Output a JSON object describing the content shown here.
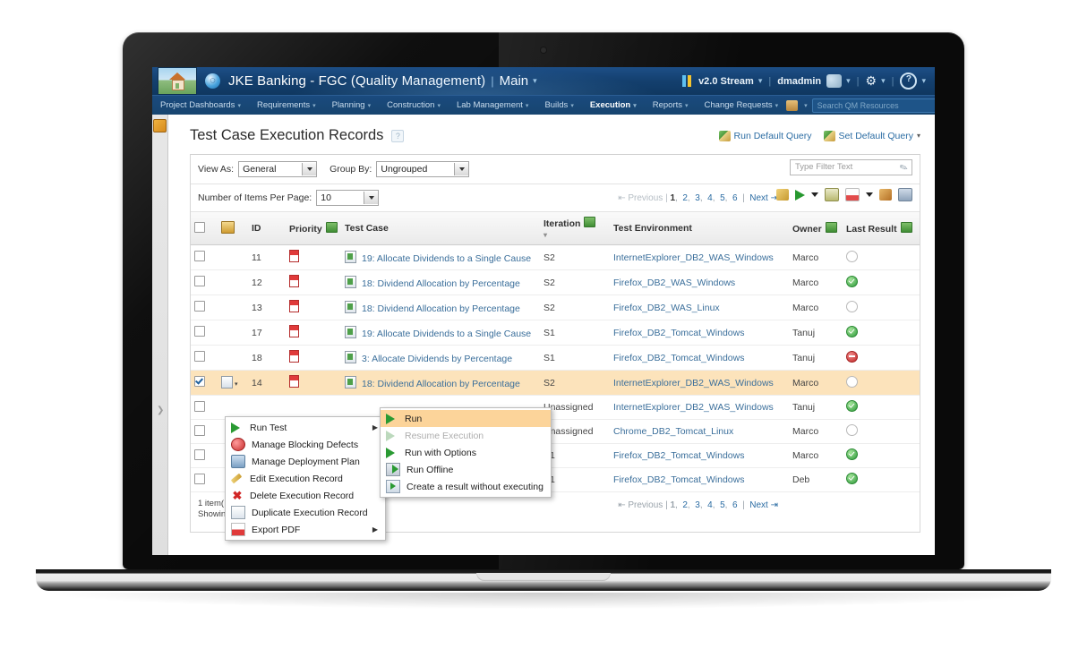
{
  "banner": {
    "home_icon": "home-icon",
    "logo_icon": "jazz-logo-icon",
    "title": "JKE Banking - FGC (Quality Management)",
    "separator": "|",
    "main_label": "Main",
    "stream_label": "v2.0 Stream",
    "user_label": "dmadmin",
    "people_icon": "people-icon",
    "gear_icon": "gear-icon",
    "help_icon": "help-icon"
  },
  "nav": {
    "items": [
      {
        "label": "Project Dashboards",
        "active": false
      },
      {
        "label": "Requirements",
        "active": false
      },
      {
        "label": "Planning",
        "active": false
      },
      {
        "label": "Construction",
        "active": false
      },
      {
        "label": "Lab Management",
        "active": false
      },
      {
        "label": "Builds",
        "active": false
      },
      {
        "label": "Execution",
        "active": true
      },
      {
        "label": "Reports",
        "active": false
      },
      {
        "label": "Change Requests",
        "active": false
      }
    ],
    "search_placeholder": "Search QM Resources",
    "search_icon": "search-icon"
  },
  "page": {
    "title": "Test Case Execution Records",
    "help_icon": "question-mark-icon",
    "run_default_query": "Run Default Query",
    "set_default_query": "Set Default Query"
  },
  "filters": {
    "view_as_label": "View As:",
    "view_as_value": "General",
    "group_by_label": "Group By:",
    "group_by_value": "Ungrouped",
    "filter_placeholder": "Type Filter Text",
    "filter_icon": "filter-pen-icon"
  },
  "paging": {
    "items_per_page_label": "Number of Items Per Page:",
    "items_per_page_value": "10",
    "first_icon": "first-page-icon",
    "previous": "Previous",
    "pages": [
      "1",
      "2",
      "3",
      "4",
      "5",
      "6"
    ],
    "current_page": "1",
    "next": "Next",
    "last_icon": "last-page-icon",
    "separator": "|"
  },
  "toolbar_icons": [
    {
      "name": "link-icon"
    },
    {
      "name": "run-icon"
    },
    {
      "name": "run-dropdown-icon"
    },
    {
      "name": "columns-icon"
    },
    {
      "name": "pdf-icon"
    },
    {
      "name": "pdf-dropdown-icon"
    },
    {
      "name": "export-icon"
    },
    {
      "name": "grid-icon"
    }
  ],
  "table": {
    "columns": [
      {
        "label": "",
        "key": "checkbox"
      },
      {
        "label": "",
        "key": "icon"
      },
      {
        "label": "ID",
        "key": "id"
      },
      {
        "label": "Priority",
        "key": "priority",
        "sortable": true
      },
      {
        "label": "Test Case",
        "key": "testcase"
      },
      {
        "label": "Iteration",
        "key": "iteration",
        "sortable": true
      },
      {
        "label": "Test Environment",
        "key": "environment"
      },
      {
        "label": "Owner",
        "key": "owner",
        "sortable": true
      },
      {
        "label": "Last Result",
        "key": "result",
        "sortable": true
      }
    ],
    "rows": [
      {
        "id": "11",
        "testcase": "19: Allocate Dividends to a Single Cause",
        "iteration": "S2",
        "environment": "InternetExplorer_DB2_WAS_Windows",
        "owner": "Marco",
        "result": "none",
        "selected": false
      },
      {
        "id": "12",
        "testcase": "18: Dividend Allocation by Percentage",
        "iteration": "S2",
        "environment": "Firefox_DB2_WAS_Windows",
        "owner": "Marco",
        "result": "pass",
        "selected": false
      },
      {
        "id": "13",
        "testcase": "18: Dividend Allocation by Percentage",
        "iteration": "S2",
        "environment": "Firefox_DB2_WAS_Linux",
        "owner": "Marco",
        "result": "none",
        "selected": false
      },
      {
        "id": "17",
        "testcase": "19: Allocate Dividends to a Single Cause",
        "iteration": "S1",
        "environment": "Firefox_DB2_Tomcat_Windows",
        "owner": "Tanuj",
        "result": "pass",
        "selected": false
      },
      {
        "id": "18",
        "testcase": "3: Allocate Dividends by Percentage",
        "iteration": "S1",
        "environment": "Firefox_DB2_Tomcat_Windows",
        "owner": "Tanuj",
        "result": "block",
        "selected": false
      },
      {
        "id": "14",
        "testcase": "18: Dividend Allocation by Percentage",
        "iteration": "S2",
        "environment": "InternetExplorer_DB2_WAS_Windows",
        "owner": "Marco",
        "result": "none",
        "selected": true
      },
      {
        "id": "",
        "testcase": "",
        "iteration": "Unassigned",
        "environment": "InternetExplorer_DB2_WAS_Windows",
        "owner": "Tanuj",
        "result": "pass",
        "selected": false
      },
      {
        "id": "",
        "testcase": "",
        "iteration": "Unassigned",
        "environment": "Chrome_DB2_Tomcat_Linux",
        "owner": "Marco",
        "result": "none",
        "selected": false
      },
      {
        "id": "",
        "testcase": "",
        "iteration": "S1",
        "environment": "Firefox_DB2_Tomcat_Windows",
        "owner": "Marco",
        "result": "pass",
        "selected": false
      },
      {
        "id": "",
        "testcase": "",
        "iteration": "S1",
        "environment": "Firefox_DB2_Tomcat_Windows",
        "owner": "Deb",
        "result": "pass",
        "selected": false
      }
    ]
  },
  "footer": {
    "count_line1": "1 item(",
    "count_line2": "Showin"
  },
  "context_menu": {
    "items": [
      {
        "label": "Run Test",
        "icon": "run-icon",
        "submenu": true,
        "disabled": false
      },
      {
        "label": "Manage Blocking Defects",
        "icon": "defect-icon",
        "submenu": false,
        "disabled": false
      },
      {
        "label": "Manage Deployment Plan",
        "icon": "deployment-icon",
        "submenu": false,
        "disabled": false
      },
      {
        "label": "Edit Execution Record",
        "icon": "pencil-icon",
        "submenu": false,
        "disabled": false
      },
      {
        "label": "Delete Execution Record",
        "icon": "delete-x-icon",
        "submenu": false,
        "disabled": false
      },
      {
        "label": "Duplicate Execution Record",
        "icon": "duplicate-icon",
        "submenu": false,
        "disabled": false
      },
      {
        "label": "Export PDF",
        "icon": "pdf-icon",
        "submenu": true,
        "disabled": false
      }
    ]
  },
  "submenu": {
    "items": [
      {
        "label": "Run",
        "icon": "run-icon",
        "highlighted": true,
        "disabled": false
      },
      {
        "label": "Resume Execution",
        "icon": "resume-icon",
        "highlighted": false,
        "disabled": true
      },
      {
        "label": "Run with Options",
        "icon": "run-options-icon",
        "highlighted": false,
        "disabled": false
      },
      {
        "label": "Run Offline",
        "icon": "run-offline-icon",
        "highlighted": false,
        "disabled": false
      },
      {
        "label": "Create a result without executing",
        "icon": "create-result-icon",
        "highlighted": false,
        "disabled": false
      }
    ]
  },
  "colors": {
    "banner": "#14406f",
    "nav": "#17456f",
    "link": "#3b6f9b",
    "selected_row": "#fce3bb",
    "highlight": "#fcd49a",
    "pass": "#2f9b3c",
    "blocked": "#c02828"
  }
}
